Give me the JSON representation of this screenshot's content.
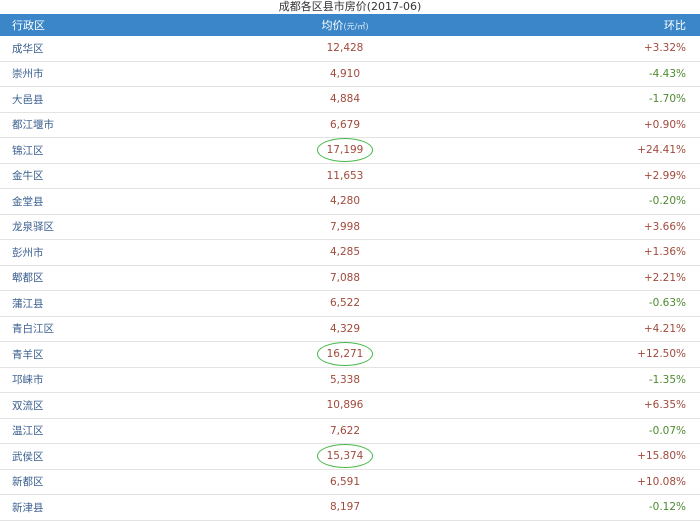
{
  "title": "成都各区县市房价(2017-06)",
  "header": {
    "name": "行政区",
    "price": "均价",
    "unit": "(元/㎡)",
    "ring": "环比"
  },
  "rows": [
    {
      "name": "成华区",
      "price": "12,428",
      "ring": "+3.32%",
      "dir": "pos",
      "circled": false
    },
    {
      "name": "崇州市",
      "price": "4,910",
      "ring": "-4.43%",
      "dir": "neg",
      "circled": false
    },
    {
      "name": "大邑县",
      "price": "4,884",
      "ring": "-1.70%",
      "dir": "neg",
      "circled": false
    },
    {
      "name": "都江堰市",
      "price": "6,679",
      "ring": "+0.90%",
      "dir": "pos",
      "circled": false
    },
    {
      "name": "锦江区",
      "price": "17,199",
      "ring": "+24.41%",
      "dir": "pos",
      "circled": true
    },
    {
      "name": "金牛区",
      "price": "11,653",
      "ring": "+2.99%",
      "dir": "pos",
      "circled": false
    },
    {
      "name": "金堂县",
      "price": "4,280",
      "ring": "-0.20%",
      "dir": "neg",
      "circled": false
    },
    {
      "name": "龙泉驿区",
      "price": "7,998",
      "ring": "+3.66%",
      "dir": "pos",
      "circled": false
    },
    {
      "name": "彭州市",
      "price": "4,285",
      "ring": "+1.36%",
      "dir": "pos",
      "circled": false
    },
    {
      "name": "郫都区",
      "price": "7,088",
      "ring": "+2.21%",
      "dir": "pos",
      "circled": false
    },
    {
      "name": "蒲江县",
      "price": "6,522",
      "ring": "-0.63%",
      "dir": "neg",
      "circled": false
    },
    {
      "name": "青白江区",
      "price": "4,329",
      "ring": "+4.21%",
      "dir": "pos",
      "circled": false
    },
    {
      "name": "青羊区",
      "price": "16,271",
      "ring": "+12.50%",
      "dir": "pos",
      "circled": true
    },
    {
      "name": "邛崃市",
      "price": "5,338",
      "ring": "-1.35%",
      "dir": "neg",
      "circled": false
    },
    {
      "name": "双流区",
      "price": "10,896",
      "ring": "+6.35%",
      "dir": "pos",
      "circled": false
    },
    {
      "name": "温江区",
      "price": "7,622",
      "ring": "-0.07%",
      "dir": "neg",
      "circled": false
    },
    {
      "name": "武侯区",
      "price": "15,374",
      "ring": "+15.80%",
      "dir": "pos",
      "circled": true
    },
    {
      "name": "新都区",
      "price": "6,591",
      "ring": "+10.08%",
      "dir": "pos",
      "circled": false
    },
    {
      "name": "新津县",
      "price": "8,197",
      "ring": "-0.12%",
      "dir": "neg",
      "circled": false
    }
  ]
}
